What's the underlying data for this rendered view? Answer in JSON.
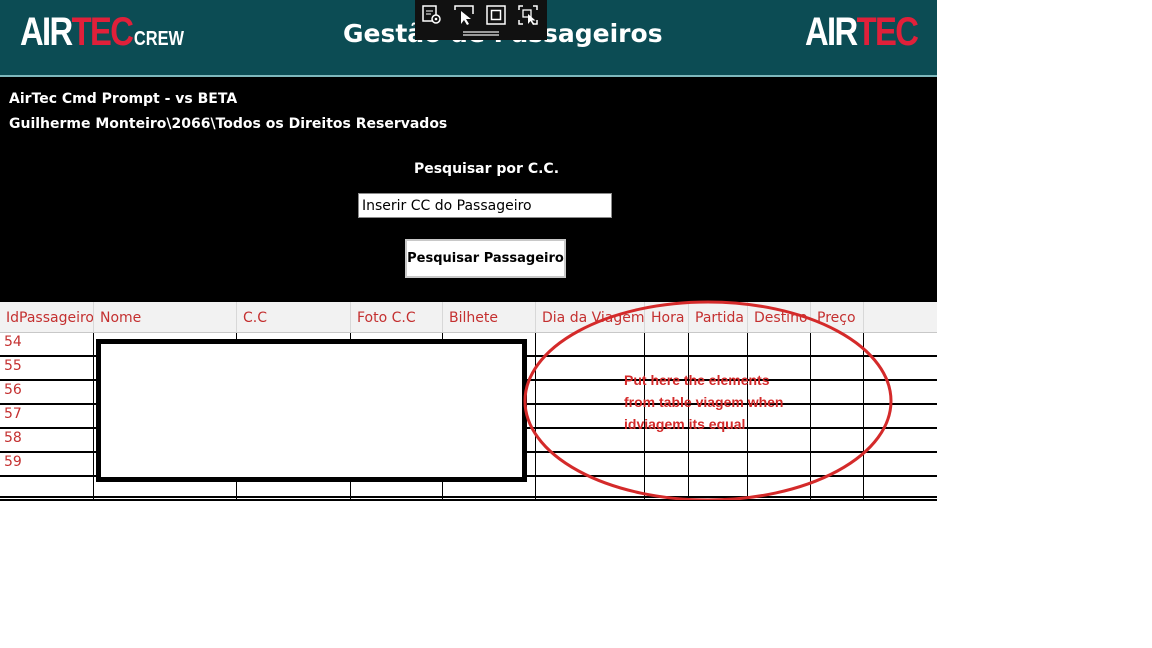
{
  "header": {
    "logo_left": {
      "air": "AIR",
      "tec": "TEC",
      "crew": "CREW"
    },
    "title": "Gestão de Passageiros",
    "logo_right": {
      "air": "AIR",
      "tec": "TEC"
    }
  },
  "toolbar": {
    "icons": [
      "select-element-icon",
      "select-pointer-icon",
      "display-layout-icon",
      "track-focus-icon"
    ]
  },
  "panel": {
    "line1": "AirTec Cmd Prompt - vs BETA",
    "line2": "Guilherme Monteiro\\2066\\Todos os Direitos Reservados",
    "search_label": "Pesquisar por C.C.",
    "search_value": "Inserir CC do Passageiro",
    "search_button": "Pesquisar Passageiro"
  },
  "grid": {
    "columns": [
      "IdPassageiro",
      "Nome",
      "C.C",
      "Foto C.C",
      "Bilhete",
      "Dia da Viagem",
      "Hora",
      "Partida",
      "Destino",
      "Preço"
    ],
    "rows": [
      "54",
      "55",
      "56",
      "57",
      "58",
      "59",
      ""
    ]
  },
  "annotation": {
    "lines": [
      "Put here the elements",
      "from table viagem when",
      "idviagem its equal"
    ]
  },
  "colors": {
    "header_bg": "#0c4c54",
    "brand_red": "#e0203a",
    "grid_text": "#c43030",
    "annotation_red": "#d42a2a"
  }
}
